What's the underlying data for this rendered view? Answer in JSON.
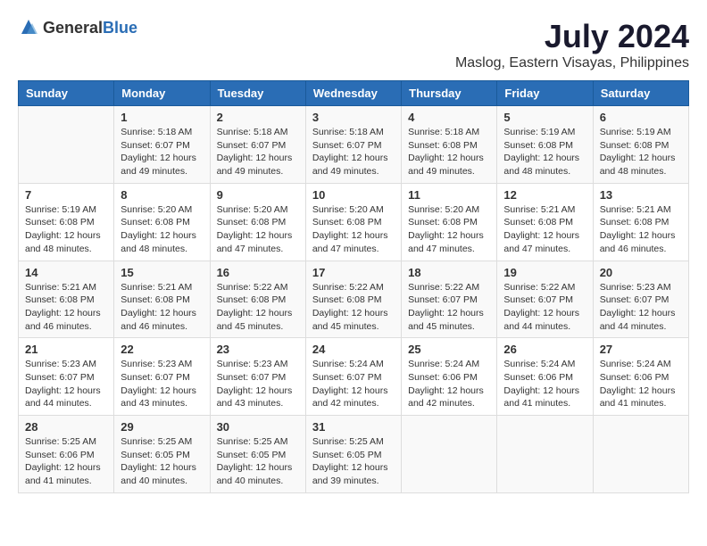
{
  "logo": {
    "text_general": "General",
    "text_blue": "Blue"
  },
  "title": "July 2024",
  "location": "Maslog, Eastern Visayas, Philippines",
  "days_of_week": [
    "Sunday",
    "Monday",
    "Tuesday",
    "Wednesday",
    "Thursday",
    "Friday",
    "Saturday"
  ],
  "weeks": [
    [
      {
        "day": "",
        "info": ""
      },
      {
        "day": "1",
        "info": "Sunrise: 5:18 AM\nSunset: 6:07 PM\nDaylight: 12 hours\nand 49 minutes."
      },
      {
        "day": "2",
        "info": "Sunrise: 5:18 AM\nSunset: 6:07 PM\nDaylight: 12 hours\nand 49 minutes."
      },
      {
        "day": "3",
        "info": "Sunrise: 5:18 AM\nSunset: 6:07 PM\nDaylight: 12 hours\nand 49 minutes."
      },
      {
        "day": "4",
        "info": "Sunrise: 5:18 AM\nSunset: 6:08 PM\nDaylight: 12 hours\nand 49 minutes."
      },
      {
        "day": "5",
        "info": "Sunrise: 5:19 AM\nSunset: 6:08 PM\nDaylight: 12 hours\nand 48 minutes."
      },
      {
        "day": "6",
        "info": "Sunrise: 5:19 AM\nSunset: 6:08 PM\nDaylight: 12 hours\nand 48 minutes."
      }
    ],
    [
      {
        "day": "7",
        "info": "Sunrise: 5:19 AM\nSunset: 6:08 PM\nDaylight: 12 hours\nand 48 minutes."
      },
      {
        "day": "8",
        "info": "Sunrise: 5:20 AM\nSunset: 6:08 PM\nDaylight: 12 hours\nand 48 minutes."
      },
      {
        "day": "9",
        "info": "Sunrise: 5:20 AM\nSunset: 6:08 PM\nDaylight: 12 hours\nand 47 minutes."
      },
      {
        "day": "10",
        "info": "Sunrise: 5:20 AM\nSunset: 6:08 PM\nDaylight: 12 hours\nand 47 minutes."
      },
      {
        "day": "11",
        "info": "Sunrise: 5:20 AM\nSunset: 6:08 PM\nDaylight: 12 hours\nand 47 minutes."
      },
      {
        "day": "12",
        "info": "Sunrise: 5:21 AM\nSunset: 6:08 PM\nDaylight: 12 hours\nand 47 minutes."
      },
      {
        "day": "13",
        "info": "Sunrise: 5:21 AM\nSunset: 6:08 PM\nDaylight: 12 hours\nand 46 minutes."
      }
    ],
    [
      {
        "day": "14",
        "info": "Sunrise: 5:21 AM\nSunset: 6:08 PM\nDaylight: 12 hours\nand 46 minutes."
      },
      {
        "day": "15",
        "info": "Sunrise: 5:21 AM\nSunset: 6:08 PM\nDaylight: 12 hours\nand 46 minutes."
      },
      {
        "day": "16",
        "info": "Sunrise: 5:22 AM\nSunset: 6:08 PM\nDaylight: 12 hours\nand 45 minutes."
      },
      {
        "day": "17",
        "info": "Sunrise: 5:22 AM\nSunset: 6:08 PM\nDaylight: 12 hours\nand 45 minutes."
      },
      {
        "day": "18",
        "info": "Sunrise: 5:22 AM\nSunset: 6:07 PM\nDaylight: 12 hours\nand 45 minutes."
      },
      {
        "day": "19",
        "info": "Sunrise: 5:22 AM\nSunset: 6:07 PM\nDaylight: 12 hours\nand 44 minutes."
      },
      {
        "day": "20",
        "info": "Sunrise: 5:23 AM\nSunset: 6:07 PM\nDaylight: 12 hours\nand 44 minutes."
      }
    ],
    [
      {
        "day": "21",
        "info": "Sunrise: 5:23 AM\nSunset: 6:07 PM\nDaylight: 12 hours\nand 44 minutes."
      },
      {
        "day": "22",
        "info": "Sunrise: 5:23 AM\nSunset: 6:07 PM\nDaylight: 12 hours\nand 43 minutes."
      },
      {
        "day": "23",
        "info": "Sunrise: 5:23 AM\nSunset: 6:07 PM\nDaylight: 12 hours\nand 43 minutes."
      },
      {
        "day": "24",
        "info": "Sunrise: 5:24 AM\nSunset: 6:07 PM\nDaylight: 12 hours\nand 42 minutes."
      },
      {
        "day": "25",
        "info": "Sunrise: 5:24 AM\nSunset: 6:06 PM\nDaylight: 12 hours\nand 42 minutes."
      },
      {
        "day": "26",
        "info": "Sunrise: 5:24 AM\nSunset: 6:06 PM\nDaylight: 12 hours\nand 41 minutes."
      },
      {
        "day": "27",
        "info": "Sunrise: 5:24 AM\nSunset: 6:06 PM\nDaylight: 12 hours\nand 41 minutes."
      }
    ],
    [
      {
        "day": "28",
        "info": "Sunrise: 5:25 AM\nSunset: 6:06 PM\nDaylight: 12 hours\nand 41 minutes."
      },
      {
        "day": "29",
        "info": "Sunrise: 5:25 AM\nSunset: 6:05 PM\nDaylight: 12 hours\nand 40 minutes."
      },
      {
        "day": "30",
        "info": "Sunrise: 5:25 AM\nSunset: 6:05 PM\nDaylight: 12 hours\nand 40 minutes."
      },
      {
        "day": "31",
        "info": "Sunrise: 5:25 AM\nSunset: 6:05 PM\nDaylight: 12 hours\nand 39 minutes."
      },
      {
        "day": "",
        "info": ""
      },
      {
        "day": "",
        "info": ""
      },
      {
        "day": "",
        "info": ""
      }
    ]
  ]
}
